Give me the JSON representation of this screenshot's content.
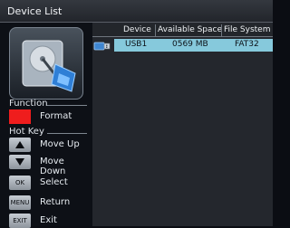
{
  "window": {
    "title": "Device List"
  },
  "sidebar": {
    "device_image_icon": "hard-disk-icon",
    "function": {
      "label": "Function",
      "items": [
        {
          "color": "#ef1d1d",
          "label": "Format"
        }
      ]
    },
    "hotkeys": {
      "label": "Hot Key",
      "items": [
        {
          "key_icon": "triangle-up-icon",
          "label": "Move Up"
        },
        {
          "key_icon": "triangle-down-icon",
          "label": "Move Down"
        },
        {
          "key": "OK",
          "label": "Select"
        },
        {
          "key": "MENU",
          "label": "Return"
        },
        {
          "key": "EXIT",
          "label": "Exit"
        }
      ]
    }
  },
  "table": {
    "columns": [
      "Device",
      "Available Space",
      "File System"
    ],
    "rows": [
      {
        "icon": "usb-drive-icon",
        "device": "USB1",
        "available_space": "0569 MB",
        "file_system": "FAT32",
        "selected": true
      }
    ],
    "selection_color": "#86c9dc"
  }
}
